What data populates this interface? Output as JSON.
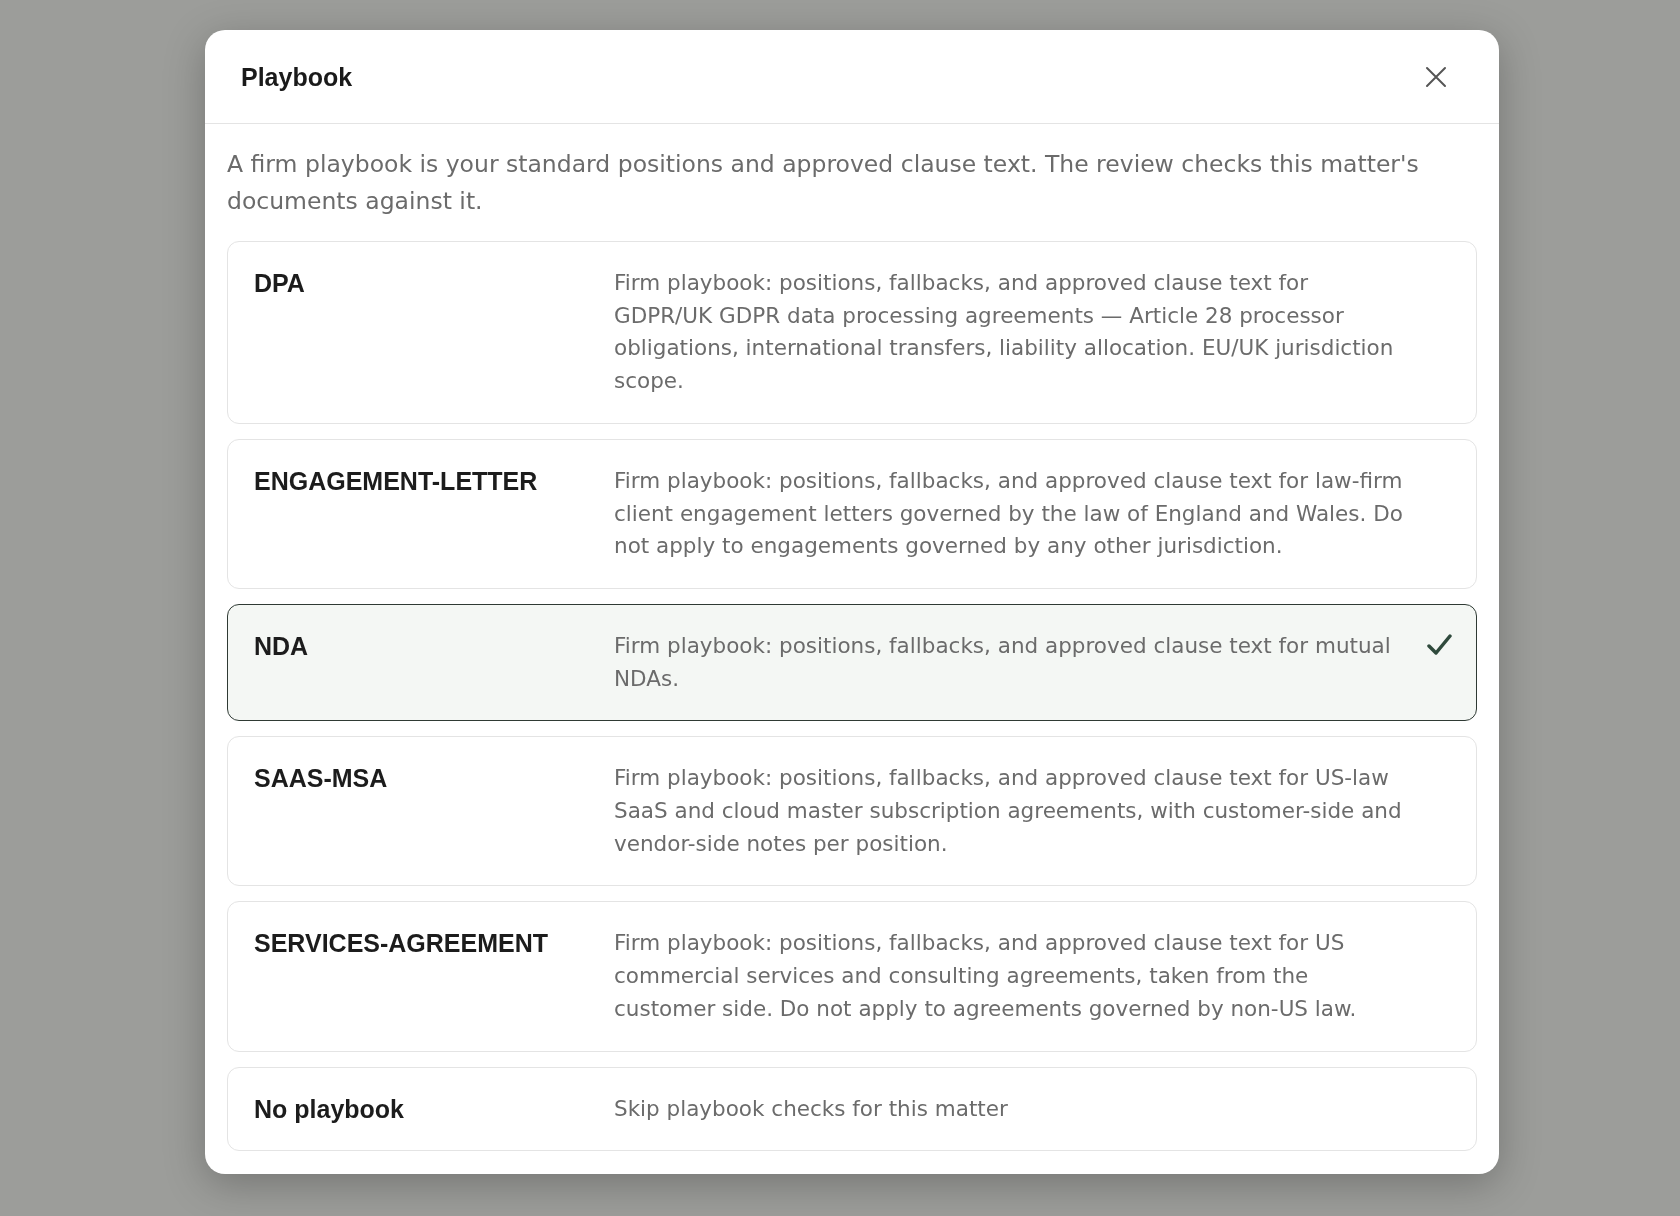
{
  "dialog": {
    "title": "Playbook",
    "intro": "A firm playbook is your standard positions and approved clause text. The review checks this matter's documents against it.",
    "options": [
      {
        "name": "DPA",
        "description": "Firm playbook: positions, fallbacks, and approved clause text for GDPR/UK GDPR data processing agreements — Article 28 processor obligations, international transfers, liability allocation. EU/UK jurisdiction scope.",
        "selected": false
      },
      {
        "name": "ENGAGEMENT-LETTER",
        "description": "Firm playbook: positions, fallbacks, and approved clause text for law-firm client engagement letters governed by the law of England and Wales. Do not apply to engagements governed by any other jurisdiction.",
        "selected": false
      },
      {
        "name": "NDA",
        "description": "Firm playbook: positions, fallbacks, and approved clause text for mutual NDAs.",
        "selected": true
      },
      {
        "name": "SAAS-MSA",
        "description": "Firm playbook: positions, fallbacks, and approved clause text for US-law SaaS and cloud master subscription agreements, with customer-side and vendor-side notes per position.",
        "selected": false
      },
      {
        "name": "SERVICES-AGREEMENT",
        "description": "Firm playbook: positions, fallbacks, and approved clause text for US commercial services and consulting agreements, taken from the customer side. Do not apply to agreements governed by non-US law.",
        "selected": false
      },
      {
        "name": "No playbook",
        "description": "Skip playbook checks for this matter",
        "selected": false
      }
    ]
  }
}
